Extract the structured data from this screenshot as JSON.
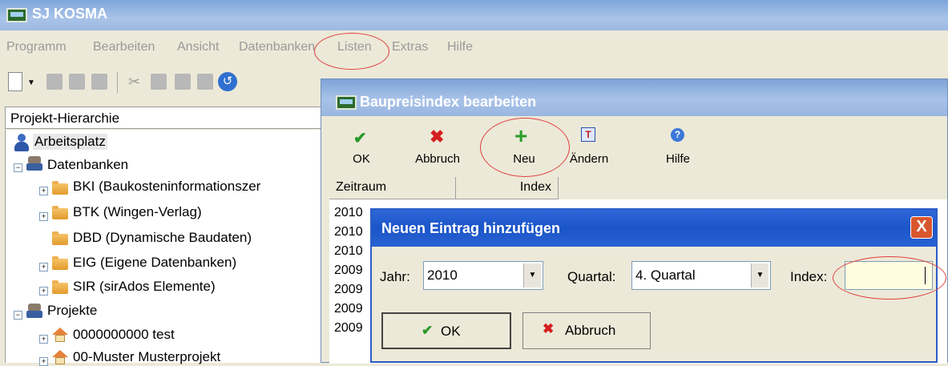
{
  "app": {
    "title": "SJ KOSMA"
  },
  "menu": {
    "items": [
      "Programm",
      "Bearbeiten",
      "Ansicht",
      "Datenbanken",
      "Listen",
      "Extras",
      "Hilfe"
    ]
  },
  "tree": {
    "header": "Projekt-Hierarchie",
    "root": "Arbeitsplatz",
    "databases_label": "Datenbanken",
    "databases": [
      "BKI (Baukosteninformationszer",
      "BTK (Wingen-Verlag)",
      "DBD (Dynamische Baudaten)",
      "EIG (Eigene Datenbanken)",
      "SIR (sirAdos Elemente)"
    ],
    "projects_label": "Projekte",
    "projects": [
      "0000000000 test",
      "00-Muster Musterprojekt"
    ]
  },
  "bp_window": {
    "title": "Baupreisindex bearbeiten",
    "buttons": {
      "ok": "OK",
      "cancel": "Abbruch",
      "new": "Neu",
      "edit": "Ändern",
      "help": "Hilfe"
    },
    "columns": [
      "Zeitraum",
      "Index"
    ],
    "rows": [
      "2010",
      "2010",
      "2010",
      "2009",
      "2009",
      "2009",
      "2009"
    ]
  },
  "dialog": {
    "title": "Neuen Eintrag hinzufügen",
    "close": "X",
    "year_label": "Jahr:",
    "year_value": "2010",
    "quarter_label": "Quartal:",
    "quarter_value": "4. Quartal",
    "index_label": "Index:",
    "index_value": "",
    "ok": "OK",
    "cancel": "Abbruch"
  },
  "colors": {
    "highlight_circle": "#e04040",
    "dialog_title": "#2b5cc8"
  }
}
